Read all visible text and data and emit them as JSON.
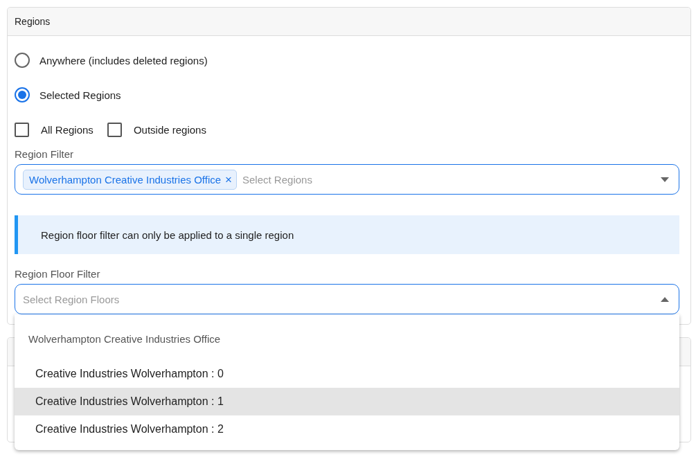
{
  "card": {
    "title": "Regions"
  },
  "scope_options": [
    {
      "label": "Anywhere (includes deleted regions)",
      "selected": false
    },
    {
      "label": "Selected Regions",
      "selected": true
    }
  ],
  "checkboxes": [
    {
      "label": "All Regions",
      "checked": false
    },
    {
      "label": "Outside regions",
      "checked": false
    }
  ],
  "region_filter": {
    "label": "Region Filter",
    "chips": [
      "Wolverhampton Creative Industries Office"
    ],
    "chip_remove": "×",
    "placeholder": "Select Regions",
    "expanded": false
  },
  "info": {
    "text": "Region floor filter can only be applied to a single region"
  },
  "floor_filter": {
    "label": "Region Floor Filter",
    "placeholder": "Select Region Floors",
    "expanded": true
  },
  "floor_menu": {
    "group": "Wolverhampton Creative Industries Office",
    "items": [
      {
        "label": "Creative Industries Wolverhampton : 0",
        "highlighted": false
      },
      {
        "label": "Creative Industries Wolverhampton : 1",
        "highlighted": true
      },
      {
        "label": "Creative Industries Wolverhampton : 2",
        "highlighted": false
      }
    ]
  }
}
